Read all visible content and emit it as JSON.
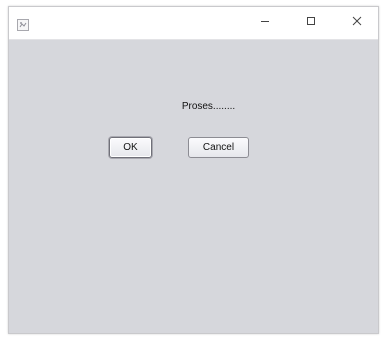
{
  "window": {
    "title": "",
    "app_icon": "java-app-icon"
  },
  "titlebar_controls": {
    "minimize_icon": "minimize-icon",
    "maximize_icon": "maximize-icon",
    "close_icon": "close-icon"
  },
  "dialog": {
    "message": "Proses........",
    "ok_label": "OK",
    "cancel_label": "Cancel"
  },
  "colors": {
    "window_background": "#d6d7dc",
    "titlebar_background": "#ffffff",
    "button_border": "#8c8c93"
  }
}
